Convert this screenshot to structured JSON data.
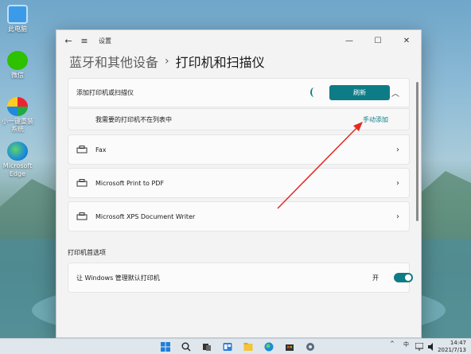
{
  "desktop": {
    "icons": [
      {
        "label": "此电脑"
      },
      {
        "label": "微信"
      },
      {
        "label": "小一键重装系统"
      },
      {
        "label": "Microsoft Edge"
      }
    ]
  },
  "window": {
    "app_title": "设置",
    "breadcrumb": {
      "parent": "蓝牙和其他设备",
      "separator": "›",
      "current": "打印机和扫描仪"
    },
    "add_printer": {
      "label": "添加打印机或扫描仪",
      "refresh_label": "刷新"
    },
    "not_listed": {
      "label": "我需要的打印机不在列表中",
      "link": "手动添加"
    },
    "printers": [
      {
        "name": "Fax"
      },
      {
        "name": "Microsoft Print to PDF"
      },
      {
        "name": "Microsoft XPS Document Writer"
      }
    ],
    "preferences": {
      "section_title": "打印机首选项",
      "default_label": "让 Windows 管理默认打印机",
      "toggle_state": "开"
    }
  },
  "taskbar": {
    "tray": {
      "chevron": "^",
      "ime": "中"
    },
    "clock": {
      "time": "14:47",
      "date": "2021/7/13"
    }
  },
  "colors": {
    "accent": "#0e7c86",
    "arrow": "#e32b24"
  }
}
